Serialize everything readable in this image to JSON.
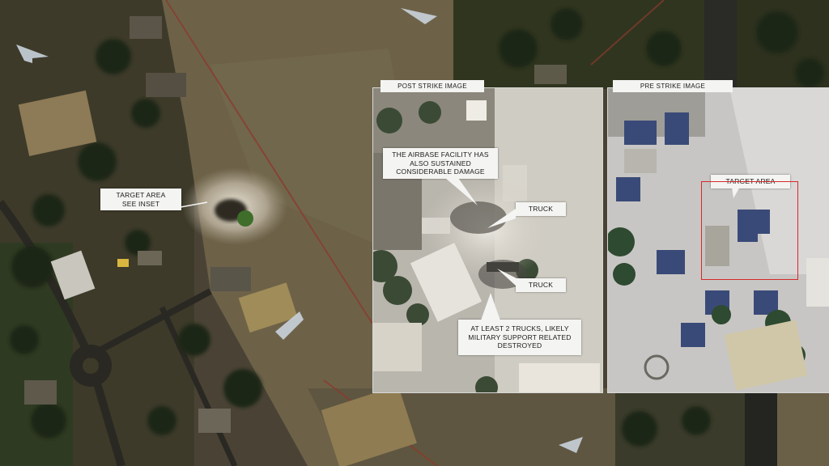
{
  "main_map": {
    "target_label_line1": "TARGET AREA",
    "target_label_line2": "SEE INSET"
  },
  "post_strike": {
    "title": "POST STRIKE IMAGE",
    "callout_damage_line1": "THE AIRBASE FACILITY HAS",
    "callout_damage_line2": "ALSO SUSTAINED",
    "callout_damage_line3": "CONSIDERABLE DAMAGE",
    "truck_label_1": "TRUCK",
    "truck_label_2": "TRUCK",
    "callout_trucks_line1": "AT LEAST 2 TRUCKS, LIKELY",
    "callout_trucks_line2": "MILITARY SUPPORT RELATED",
    "callout_trucks_line3": "DESTROYED"
  },
  "pre_strike": {
    "title": "PRE STRIKE IMAGE",
    "target_label": "TARGET AREA"
  },
  "colors": {
    "target_box": "#d42a2a",
    "callout_bg": "#f4f4f2"
  }
}
